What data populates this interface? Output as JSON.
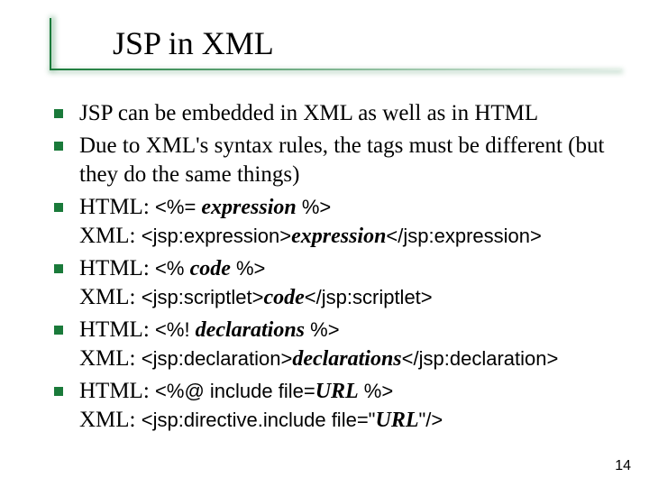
{
  "slide": {
    "title": "JSP in XML",
    "page_number": "14"
  },
  "bullets": [
    {
      "plain": "JSP can be embedded in XML as well as in HTML"
    },
    {
      "plain": "Due to XML's syntax rules, the tags must be different (but they do the same things)"
    },
    {
      "html_label": "HTML: ",
      "html_code_pre": "<%= ",
      "html_code_ital": "expression",
      "html_code_post": " %>",
      "xml_label": "XML: ",
      "xml_code_pre": "<jsp:expression>",
      "xml_code_ital": "expression",
      "xml_code_post": "</jsp:expression>"
    },
    {
      "html_label": "HTML: ",
      "html_code_pre": "<% ",
      "html_code_ital": "code",
      "html_code_post": " %>",
      "xml_label": "XML: ",
      "xml_code_pre": "<jsp:scriptlet>",
      "xml_code_ital": "code",
      "xml_code_post": "</jsp:scriptlet>"
    },
    {
      "html_label": "HTML: ",
      "html_code_pre": "<%! ",
      "html_code_ital": "declarations",
      "html_code_post": " %>",
      "xml_label": "XML: ",
      "xml_code_pre": "<jsp:declaration>",
      "xml_code_ital": "declarations",
      "xml_code_post": "</jsp:declaration>"
    },
    {
      "html_label": "HTML: ",
      "html_code_pre": "<%@ include file=",
      "html_code_ital": "URL",
      "html_code_post": " %>",
      "xml_label": "XML: ",
      "xml_code_pre": "<jsp:directive.include file=\"",
      "xml_code_ital": "URL",
      "xml_code_post": "\"/>"
    }
  ]
}
